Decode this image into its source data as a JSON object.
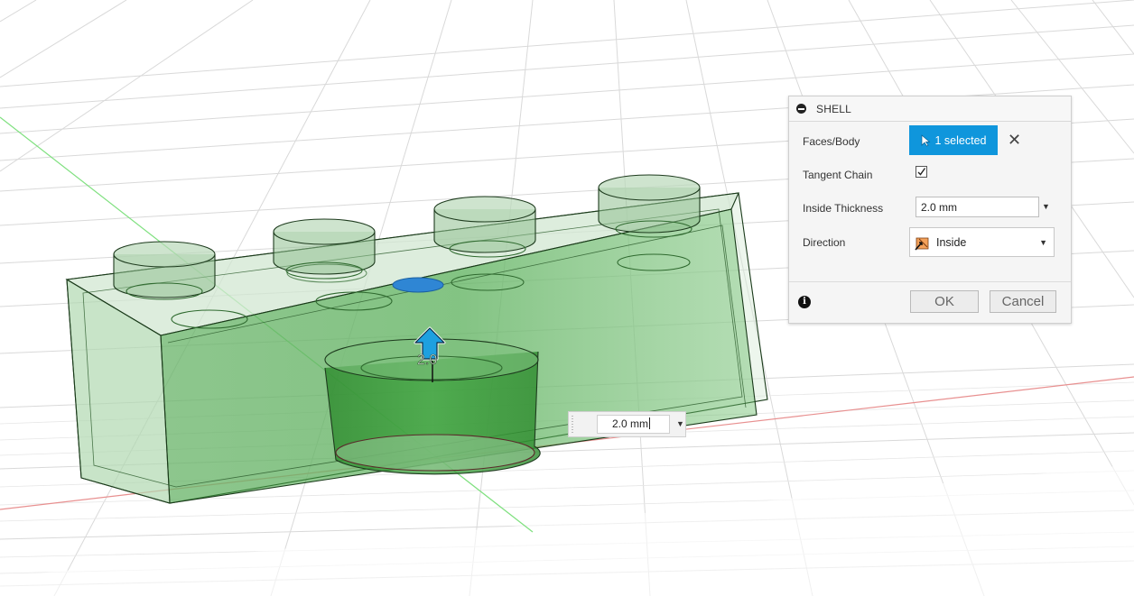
{
  "dialog": {
    "title": "SHELL",
    "faces_body": {
      "label": "Faces/Body",
      "value": "1 selected"
    },
    "tangent_chain": {
      "label": "Tangent Chain",
      "checked": true
    },
    "inside_thickness": {
      "label": "Inside Thickness",
      "value": "2.0 mm"
    },
    "direction": {
      "label": "Direction",
      "value": "Inside"
    },
    "ok_label": "OK",
    "cancel_label": "Cancel",
    "accent_color": "#0f96dc"
  },
  "viewport": {
    "thickness_input_value": "2.0 mm",
    "manipulator_label": "2.0",
    "body_color": "#3a9a3a",
    "selected_face_color": "#2f86d4"
  }
}
